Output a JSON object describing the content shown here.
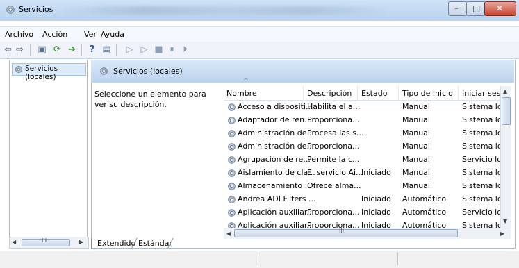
{
  "window": {
    "title": "Servicios",
    "controls": {
      "minimize": "–",
      "maximize": "□",
      "close": "✕"
    }
  },
  "menu": [
    "Archivo",
    "Acción",
    "Ver",
    "Ayuda"
  ],
  "tree": {
    "selected_item": "Servicios (locales)"
  },
  "pane_header": "Servicios (locales)",
  "description_text": "Seleccione un elemento para ver su descripción.",
  "columns": [
    "Nombre",
    "Descripción",
    "Estado",
    "Tipo de inicio",
    "Iniciar sesió"
  ],
  "rows": [
    {
      "name": "Acceso a dispositi...",
      "description": "Habilita el a...",
      "status": "",
      "startup": "Manual",
      "logon": "Sistema loc"
    },
    {
      "name": "Adaptador de ren...",
      "description": "Proporciona...",
      "status": "",
      "startup": "Manual",
      "logon": "Sistema loc"
    },
    {
      "name": "Administración de...",
      "description": "Procesa las s...",
      "status": "",
      "startup": "Manual",
      "logon": "Sistema loc"
    },
    {
      "name": "Administración de...",
      "description": "Proporciona...",
      "status": "",
      "startup": "Manual",
      "logon": "Sistema loc"
    },
    {
      "name": "Agrupación de re...",
      "description": "Permite la c...",
      "status": "",
      "startup": "Manual",
      "logon": "Servicio loc"
    },
    {
      "name": "Aislamiento de cla...",
      "description": "El servicio Ai...",
      "status": "Iniciado",
      "startup": "Manual",
      "logon": "Sistema loc"
    },
    {
      "name": "Almacenamiento ...",
      "description": "Ofrece alma...",
      "status": "",
      "startup": "Manual",
      "logon": "Sistema loc"
    },
    {
      "name": "Andrea ADI Filters ...",
      "description": "",
      "status": "Iniciado",
      "startup": "Automático",
      "logon": "Sistema loc"
    },
    {
      "name": "Aplicación auxiliar...",
      "description": "Proporciona...",
      "status": "Iniciado",
      "startup": "Automático",
      "logon": "Servicio loc"
    },
    {
      "name": "Aplicación auxiliar...",
      "description": "Proporciona...",
      "status": "Iniciado",
      "startup": "Automático",
      "logon": "Sistema loc"
    }
  ],
  "tabs": [
    "Extendido",
    "Estándar"
  ],
  "scroll_grip": "III",
  "colors": {
    "accent": "#3f72b7",
    "header_bg": "#bcd3ee",
    "selection": "#dcebfb"
  },
  "icons": {
    "title": "gear-icon",
    "service": "gear-icon",
    "toolbar": [
      "back-icon",
      "forward-icon",
      "console-tree-icon",
      "refresh-icon",
      "export-icon",
      "help-icon",
      "properties-icon",
      "start-icon",
      "start-alt-icon",
      "stop-icon",
      "pause-icon",
      "restart-icon"
    ]
  }
}
